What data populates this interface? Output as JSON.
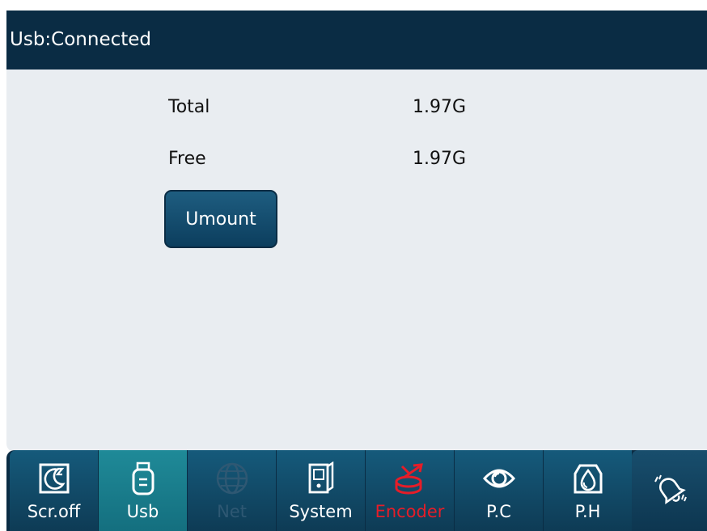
{
  "header": {
    "title": "Usb:Connected"
  },
  "storage": {
    "total_label": "Total",
    "total_value": "1.97G",
    "free_label": "Free",
    "free_value": "1.97G"
  },
  "actions": {
    "umount_label": "Umount"
  },
  "tabs": [
    {
      "label": "Scr.off",
      "icon": "screen-off-icon",
      "state": "normal"
    },
    {
      "label": "Usb",
      "icon": "usb-drive-icon",
      "state": "active"
    },
    {
      "label": "Net",
      "icon": "globe-icon",
      "state": "disabled"
    },
    {
      "label": "System",
      "icon": "system-device-icon",
      "state": "normal"
    },
    {
      "label": "Encoder",
      "icon": "encoder-icon",
      "state": "alert"
    },
    {
      "label": "P.C",
      "icon": "eye-icon",
      "state": "normal"
    },
    {
      "label": "P.H",
      "icon": "print-head-icon",
      "state": "normal"
    }
  ],
  "alarm": {
    "icon": "bell-icon"
  },
  "colors": {
    "header_bg": "#0a2c44",
    "panel_bg": "#e9edf1",
    "tab_bg": "#155a7b",
    "tab_active_bg": "#1f8a98",
    "alert_text": "#e61d28",
    "disabled_text": "#2e5873"
  }
}
